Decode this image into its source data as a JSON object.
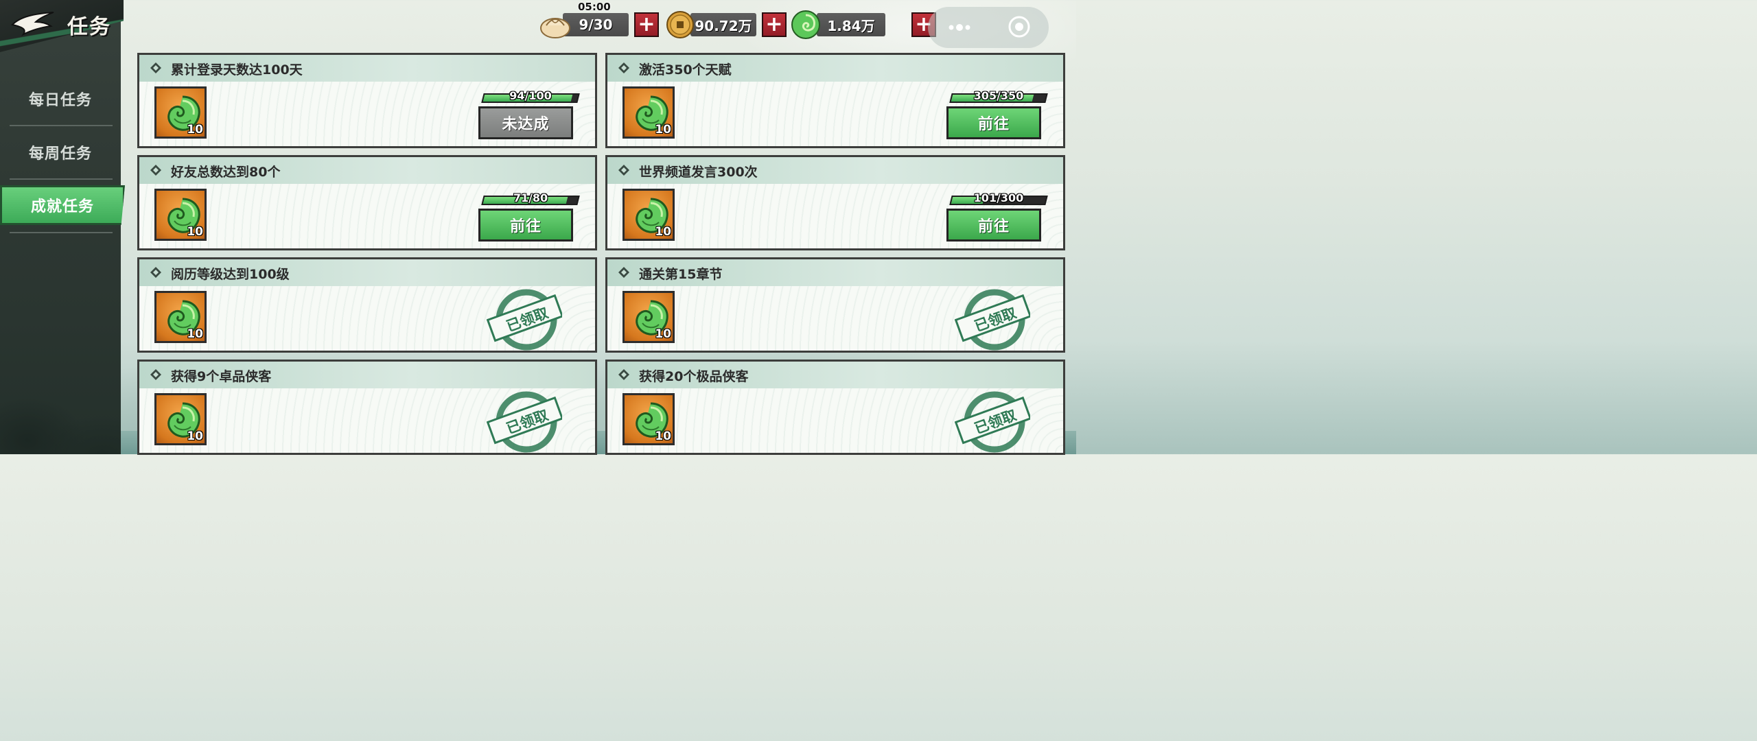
{
  "header": {
    "title": "任务"
  },
  "timer": "05:00",
  "resources": {
    "stamina": {
      "value": "9/30",
      "icon": "bun-icon"
    },
    "coins": {
      "value": "90.72万",
      "icon": "coin-icon"
    },
    "jade": {
      "value": "1.84万",
      "icon": "jade-swirl-icon"
    }
  },
  "sidebar": {
    "items": [
      {
        "label": "每日任务",
        "active": false
      },
      {
        "label": "每周任务",
        "active": false
      },
      {
        "label": "成就任务",
        "active": true
      }
    ]
  },
  "tasks": [
    {
      "title": "累计登录天数达100天",
      "reward_qty": "10",
      "progress": "94/100",
      "progress_ratio": 0.94,
      "status": "未达成"
    },
    {
      "title": "激活350个天赋",
      "reward_qty": "10",
      "progress": "305/350",
      "progress_ratio": 0.871,
      "status": "前往"
    },
    {
      "title": "好友总数达到80个",
      "reward_qty": "10",
      "progress": "71/80",
      "progress_ratio": 0.8875,
      "status": "前往"
    },
    {
      "title": "世界频道发言300次",
      "reward_qty": "10",
      "progress": "101/300",
      "progress_ratio": 0.337,
      "status": "前往"
    },
    {
      "title": "阅历等级达到100级",
      "reward_qty": "10",
      "status": "已领取"
    },
    {
      "title": "通关第15章节",
      "reward_qty": "10",
      "status": "已领取"
    },
    {
      "title": "获得9个卓品侠客",
      "reward_qty": "10",
      "status": "已领取"
    },
    {
      "title": "获得20个极品侠客",
      "reward_qty": "10",
      "status": "已领取"
    }
  ],
  "colors": {
    "accent_green": "#3ba84b",
    "plus_red": "#c2323b",
    "reward_orange": "#d6781e"
  }
}
